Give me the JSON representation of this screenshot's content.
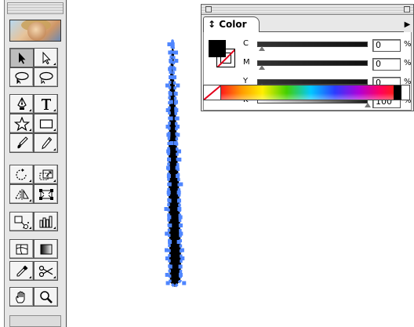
{
  "color_panel": {
    "tab_label": "Color",
    "tab_arrows": "↕",
    "menu_arrow": "▶",
    "fill_color": "#000000",
    "stroke_swatch": "none",
    "channels": [
      {
        "letter": "C",
        "value": "0",
        "pct": "%"
      },
      {
        "letter": "M",
        "value": "0",
        "pct": "%"
      },
      {
        "letter": "Y",
        "value": "0",
        "pct": "%"
      },
      {
        "letter": "K",
        "value": "100",
        "pct": "%"
      }
    ]
  },
  "toolbox": {
    "tools": [
      "selection-tool",
      "direct-selection-tool",
      "lasso-tool",
      "direct-lasso-tool",
      "pen-tool",
      "type-tool",
      "star-tool",
      "rectangle-tool",
      "paintbrush-tool",
      "pencil-tool",
      "rotate-tool",
      "scale-tool",
      "reflect-tool",
      "free-transform-tool",
      "symbol-sprayer-tool",
      "column-graph-tool",
      "mesh-tool",
      "gradient-tool",
      "eyedropper-tool",
      "scissors-tool",
      "hand-tool",
      "zoom-tool"
    ]
  },
  "colors": {
    "stroke_fill": "#000000",
    "selection_handle": "#4f86ff"
  }
}
